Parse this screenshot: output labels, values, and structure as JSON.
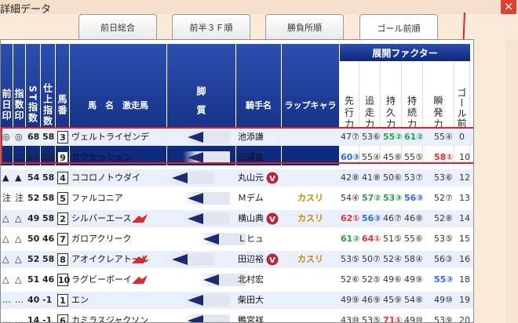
{
  "window": {
    "title": "詳細データ",
    "close": "×"
  },
  "tabs": [
    {
      "label": "前日総合"
    },
    {
      "label": "前半３Ｆ順"
    },
    {
      "label": "勝負所順"
    },
    {
      "label": "ゴール前順"
    }
  ],
  "headers": {
    "zenjitsu": "前日印",
    "shisu": "指数印",
    "st": "ST指数",
    "shiage": "仕上指数",
    "umaban": "馬番",
    "bamei": "馬　名　激走馬",
    "kyakushitsu": "脚質",
    "kishu": "騎手名",
    "lap": "ラップキャラ",
    "tenkai": "展開ファクター",
    "factors": [
      "先行力",
      "追走力",
      "持久力",
      "持続力",
      "瞬発力",
      "ゴール前差"
    ]
  },
  "colors": {
    "header": "#173a9a",
    "highlight": "#e2202a",
    "lap": "#c88800",
    "blue": "#2d6be0",
    "green": "#2f9f46",
    "red": "#e23030"
  },
  "rows": [
    {
      "m1": "◎",
      "m2": "◎",
      "st": "68",
      "sh": "58",
      "no": "3",
      "name": "ヴェルトライゼンデ",
      "flag": false,
      "kyaku": 1,
      "jockey": "池添謙",
      "v": false,
      "lap": "",
      "f": [
        {
          "t": "47⑦",
          "c": "norm"
        },
        {
          "t": "53⑥",
          "c": "norm"
        },
        {
          "t": "55②",
          "c": "green"
        },
        {
          "t": "61②",
          "c": "green"
        },
        {
          "t": "55④",
          "c": "norm"
        },
        {
          "t": "0",
          "c": "norm"
        }
      ]
    },
    {
      "m1": "○",
      "m2": "○",
      "st": "62",
      "sh": "58",
      "no": "9",
      "name": "サクセッション",
      "flag": false,
      "kyaku": 1,
      "jockey": "三浦皇",
      "v": false,
      "lap": "",
      "f": [
        {
          "t": "60③",
          "c": "blue"
        },
        {
          "t": "55④",
          "c": "norm"
        },
        {
          "t": "45⑧",
          "c": "norm"
        },
        {
          "t": "55⑤",
          "c": "norm"
        },
        {
          "t": "58①",
          "c": "red"
        },
        {
          "t": "10",
          "c": "norm"
        }
      ]
    },
    {
      "m1": "▲",
      "m2": "▲",
      "st": "54",
      "sh": "58",
      "no": "4",
      "name": "ココロノトウダイ",
      "flag": false,
      "kyaku": 0,
      "jockey": "丸山元",
      "v": true,
      "lap": "",
      "f": [
        {
          "t": "42⑧",
          "c": "norm"
        },
        {
          "t": "41⑧",
          "c": "norm"
        },
        {
          "t": "50⑥",
          "c": "norm"
        },
        {
          "t": "53⑦",
          "c": "norm"
        },
        {
          "t": "53⑥",
          "c": "norm"
        },
        {
          "t": "12",
          "c": "norm"
        }
      ]
    },
    {
      "m1": "注",
      "m2": "注",
      "st": "52",
      "sh": "58",
      "no": "5",
      "name": "ファルコニア",
      "flag": false,
      "kyaku": 1,
      "jockey": "Ｍデム",
      "v": false,
      "lap": "カスリ",
      "f": [
        {
          "t": "54④",
          "c": "norm"
        },
        {
          "t": "57②",
          "c": "green"
        },
        {
          "t": "53③",
          "c": "green"
        },
        {
          "t": "56③",
          "c": "blue"
        },
        {
          "t": "52⑦",
          "c": "norm"
        },
        {
          "t": "13",
          "c": "norm"
        }
      ]
    },
    {
      "m1": "△",
      "m2": "△",
      "st": "49",
      "sh": "58",
      "no": "2",
      "name": "シルバーエース",
      "flag": true,
      "kyaku": 1,
      "jockey": "横山典",
      "v": true,
      "lap": "カスリ",
      "f": [
        {
          "t": "62①",
          "c": "red"
        },
        {
          "t": "56③",
          "c": "blue"
        },
        {
          "t": "46⑦",
          "c": "norm"
        },
        {
          "t": "46⑧",
          "c": "norm"
        },
        {
          "t": "52⑧",
          "c": "norm"
        },
        {
          "t": "14",
          "c": "norm"
        }
      ]
    },
    {
      "m1": "△",
      "m2": "△",
      "st": "50",
      "sh": "46",
      "no": "7",
      "name": "ガロアクリーク",
      "flag": false,
      "kyaku": 2,
      "jockey": "Ｌヒュ",
      "v": false,
      "lap": "",
      "f": [
        {
          "t": "61②",
          "c": "green"
        },
        {
          "t": "64①",
          "c": "red"
        },
        {
          "t": "51⑤",
          "c": "norm"
        },
        {
          "t": "55⑥",
          "c": "norm"
        },
        {
          "t": "53⑤",
          "c": "norm"
        },
        {
          "t": "15",
          "c": "norm"
        }
      ]
    },
    {
      "m1": "△",
      "m2": "△",
      "st": "52",
      "sh": "58",
      "no": "8",
      "name": "アオイクレアトール",
      "flag": true,
      "kyaku": 0,
      "jockey": "田辺裕",
      "v": true,
      "lap": "カスリ",
      "f": [
        {
          "t": "53⑤",
          "c": "norm"
        },
        {
          "t": "50⑦",
          "c": "norm"
        },
        {
          "t": "52④",
          "c": "norm"
        },
        {
          "t": "58④",
          "c": "norm"
        },
        {
          "t": "56③",
          "c": "norm"
        },
        {
          "t": "16",
          "c": "norm"
        }
      ]
    },
    {
      "m1": "△",
      "m2": "△",
      "st": "51",
      "sh": "46",
      "no": "10",
      "name": "ラグビーボーイ",
      "flag": true,
      "kyaku": 2,
      "jockey": "北村宏",
      "v": false,
      "lap": "",
      "f": [
        {
          "t": "52⑥",
          "c": "norm"
        },
        {
          "t": "52⑤",
          "c": "norm"
        },
        {
          "t": "49⑥",
          "c": "norm"
        },
        {
          "t": "49⑨",
          "c": "norm"
        },
        {
          "t": "55③",
          "c": "blue"
        },
        {
          "t": "18",
          "c": "norm"
        }
      ]
    },
    {
      "m1": "…",
      "m2": "…",
      "st": "40",
      "sh": "-1",
      "no": "1",
      "name": "エン",
      "flag": false,
      "kyaku": 1,
      "jockey": "柴田大",
      "v": false,
      "lap": "",
      "f": [
        {
          "t": "49⑨",
          "c": "norm"
        },
        {
          "t": "46⑨",
          "c": "norm"
        },
        {
          "t": "45⑨",
          "c": "norm"
        },
        {
          "t": "54⑧",
          "c": "norm"
        },
        {
          "t": "49⑩",
          "c": "norm"
        },
        {
          "t": "19",
          "c": "norm"
        }
      ]
    },
    {
      "m1": "…",
      "m2": "…",
      "st": "14",
      "sh": "-1",
      "no": "6",
      "name": "カミラスジャクソン",
      "flag": false,
      "kyaku": 1,
      "jockey": "鴨宮祥",
      "v": false,
      "lap": "",
      "f": [
        {
          "t": "43⑩",
          "c": "norm"
        },
        {
          "t": "53⑤",
          "c": "norm"
        },
        {
          "t": "71①",
          "c": "red"
        },
        {
          "t": "49⑩",
          "c": "norm"
        },
        {
          "t": "53⑨",
          "c": "norm"
        },
        {
          "t": "20",
          "c": "norm"
        }
      ]
    }
  ]
}
